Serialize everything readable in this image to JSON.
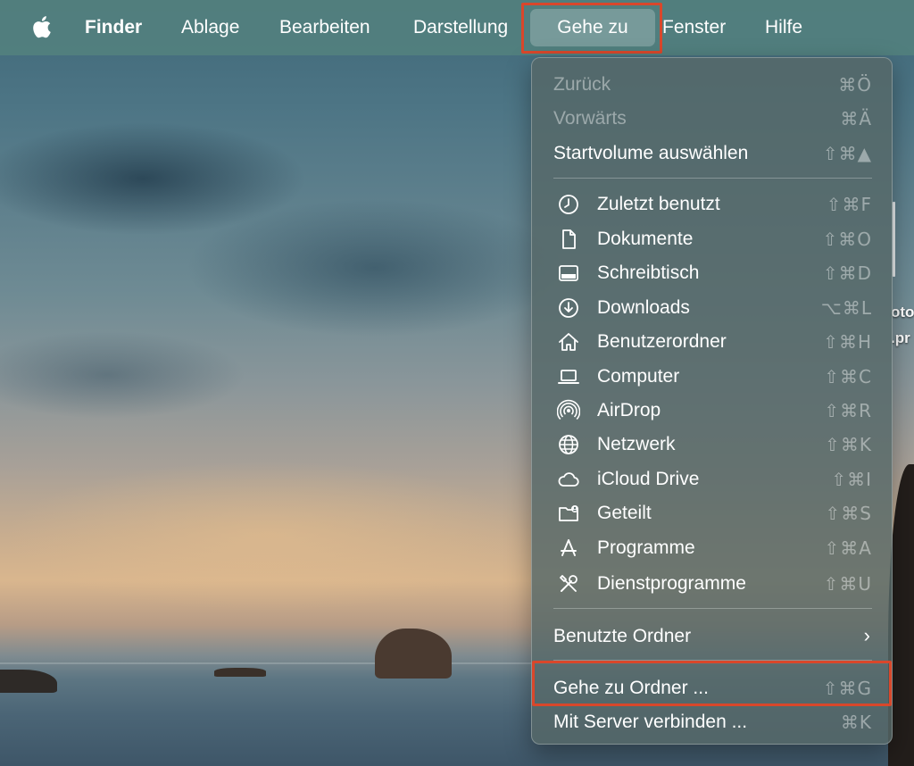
{
  "menubar": {
    "apple_icon": "apple-logo-icon",
    "items": [
      {
        "label": "Finder"
      },
      {
        "label": "Ablage"
      },
      {
        "label": "Bearbeiten"
      },
      {
        "label": "Darstellung"
      },
      {
        "label": "Gehe zu"
      },
      {
        "label": "Fenster"
      },
      {
        "label": "Hilfe"
      }
    ]
  },
  "desktop": {
    "label_fragments": [
      "oto",
      ".pr"
    ]
  },
  "go_menu": {
    "top_items": [
      {
        "label": "Zurück",
        "shortcut": "⌘Ö",
        "enabled": false
      },
      {
        "label": "Vorwärts",
        "shortcut": "⌘Ä",
        "enabled": false
      },
      {
        "label": "Startvolume auswählen",
        "shortcut": "⇧⌘▲",
        "enabled": true
      }
    ],
    "places": [
      {
        "label": "Zuletzt benutzt",
        "shortcut": "⇧⌘F",
        "icon": "clock-icon"
      },
      {
        "label": "Dokumente",
        "shortcut": "⇧⌘O",
        "icon": "document-icon"
      },
      {
        "label": "Schreibtisch",
        "shortcut": "⇧⌘D",
        "icon": "desktop-icon"
      },
      {
        "label": "Downloads",
        "shortcut": "⌥⌘L",
        "icon": "download-icon"
      },
      {
        "label": "Benutzerordner",
        "shortcut": "⇧⌘H",
        "icon": "home-icon"
      },
      {
        "label": "Computer",
        "shortcut": "⇧⌘C",
        "icon": "laptop-icon"
      },
      {
        "label": "AirDrop",
        "shortcut": "⇧⌘R",
        "icon": "airdrop-icon"
      },
      {
        "label": "Netzwerk",
        "shortcut": "⇧⌘K",
        "icon": "globe-icon"
      },
      {
        "label": "iCloud Drive",
        "shortcut": "⇧⌘I",
        "icon": "cloud-icon"
      },
      {
        "label": "Geteilt",
        "shortcut": "⇧⌘S",
        "icon": "shared-folder-icon"
      },
      {
        "label": "Programme",
        "shortcut": "⇧⌘A",
        "icon": "applications-icon"
      },
      {
        "label": "Dienstprogramme",
        "shortcut": "⇧⌘U",
        "icon": "utilities-icon"
      }
    ],
    "recent_folders": {
      "label": "Benutzte Ordner"
    },
    "go_to_folder": {
      "label": "Gehe zu Ordner ...",
      "shortcut": "⇧⌘G"
    },
    "connect_server": {
      "label": "Mit Server verbinden ...",
      "shortcut": "⌘K"
    }
  },
  "colors": {
    "highlight_box": "#d9472b",
    "menubar": "#52807e"
  }
}
